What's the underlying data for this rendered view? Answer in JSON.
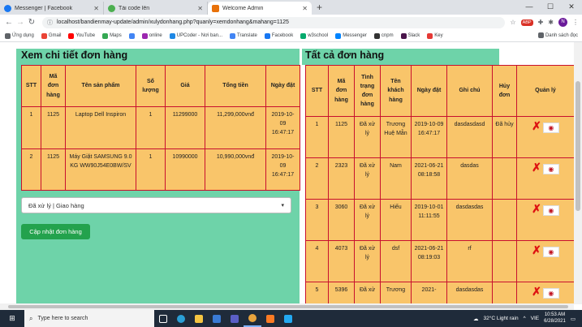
{
  "browser": {
    "tabs": [
      {
        "title": "Messenger | Facebook",
        "color": "#1877f2"
      },
      {
        "title": "Tải code lên",
        "color": "#4caf50"
      },
      {
        "title": "Welcome Admin",
        "color": "#e8710a"
      }
    ],
    "new_tab": "+",
    "url": "localhost/bandienmay-update/admin/xulydonhang.php?quanly=xemdonhang&mahang=1125",
    "profile_initial": "N"
  },
  "bookmarks": [
    {
      "label": "Ứng dụng",
      "color": "#5f6368"
    },
    {
      "label": "Gmail",
      "color": "#ea4335"
    },
    {
      "label": "YouTube",
      "color": "#ff0000"
    },
    {
      "label": "Maps",
      "color": "#34a853"
    },
    {
      "label": "",
      "color": "#4285f4"
    },
    {
      "label": "online",
      "color": "#9c27b0"
    },
    {
      "label": "UPCoder - Nơi ban...",
      "color": "#1e88e5"
    },
    {
      "label": "Translate",
      "color": "#4285f4"
    },
    {
      "label": "Facebook",
      "color": "#1877f2"
    },
    {
      "label": "w3school",
      "color": "#04aa6d"
    },
    {
      "label": "Messenger",
      "color": "#0084ff"
    },
    {
      "label": "cnpm",
      "color": "#333333"
    },
    {
      "label": "Slack",
      "color": "#4a154b"
    },
    {
      "label": "Key",
      "color": "#e53935"
    }
  ],
  "bookmarks_other": "Danh sách đọc",
  "left": {
    "title": "Xem chi tiết đơn hàng",
    "headers": [
      "STT",
      "Mã đơn hàng",
      "Tên sản phẩm",
      "Số lượng",
      "Giá",
      "Tổng tiền",
      "Ngày đặt"
    ],
    "rows": [
      [
        "1",
        "1125",
        "Laptop Dell Inspiron",
        "1",
        "11299000",
        "11,299,000vnđ",
        "2019-10-09 16:47:17"
      ],
      [
        "2",
        "1125",
        "Máy Giặt SAMSUNG 9.0 KG WW90J54E0BW/SV",
        "1",
        "10990000",
        "10,990,000vnđ",
        "2019-10-09 16:47:17"
      ]
    ],
    "status_select": "Đã xử lý | Giao hàng",
    "update_button": "Cập nhật đơn hàng"
  },
  "right": {
    "title": "Tất cả đơn hàng",
    "headers": [
      "STT",
      "Mã đơn hàng",
      "Tình trạng đơn hàng",
      "Tên khách hàng",
      "Ngày đặt",
      "Ghi chú",
      "Hủy đơn",
      "Quản lý"
    ],
    "rows": [
      [
        "1",
        "1125",
        "Đã xử lý",
        "Trương Huệ Mẫn",
        "2019-10-09 16:47:17",
        "dasdasdasd",
        "Đã hủy"
      ],
      [
        "2",
        "2323",
        "Đã xử lý",
        "Nam",
        "2021-06-21 08:18:58",
        "dasdas",
        ""
      ],
      [
        "3",
        "3060",
        "Đã xử lý",
        "Hiếu",
        "2019-10-01 11:11:55",
        "dasdasdas",
        ""
      ],
      [
        "4",
        "4073",
        "Đã xử lý",
        "dsf",
        "2021-06-21 08:19:03",
        "rf",
        ""
      ],
      [
        "5",
        "5396",
        "Đã xử",
        "Trương",
        "2021-",
        "dasdasdas",
        ""
      ]
    ]
  },
  "taskbar": {
    "search_placeholder": "Type here to search",
    "weather": "32°C  Light rain",
    "lang": "VIE",
    "time": "10:53 AM",
    "date": "6/28/2021"
  }
}
